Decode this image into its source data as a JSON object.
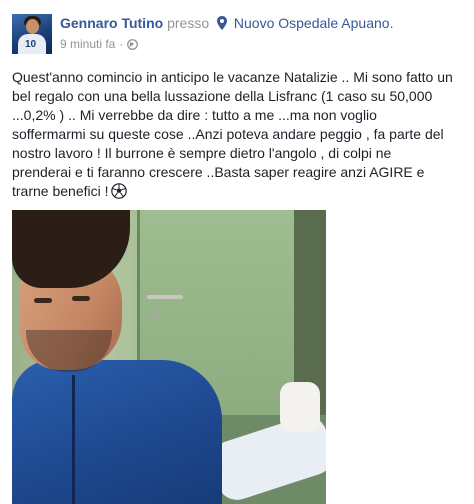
{
  "post": {
    "author": "Gennaro Tutino",
    "presso_label": "presso",
    "location": "Nuovo Ospedale Apuano.",
    "timestamp": "9 minuti fa",
    "separator": "·",
    "icons": {
      "location": "map-pin-icon",
      "privacy": "globe-icon",
      "emoji": "soccer-ball-icon"
    },
    "text_lines": [
      "Quest'anno comincio in anticipo le vacanze Natalizie .. Mi sono fatto un",
      "bel regalo con una bella lussazione della Lisfranc (1 caso su 50,000",
      "...0,2% ) .. Mi verrebbe da dire : tutto a me ...ma non voglio",
      "soffermarmi su queste cose ..Anzi poteva andare peggio , fa parte del",
      "nostro lavoro ! Il burrone è sempre dietro l'angolo , di colpi ne",
      "prenderai e ti faranno crescere ..Basta saper reagire anzi AGIRE e",
      "trarne benefici !"
    ]
  },
  "colors": {
    "link": "#365899",
    "meta": "#90949c",
    "text": "#1d2129"
  }
}
